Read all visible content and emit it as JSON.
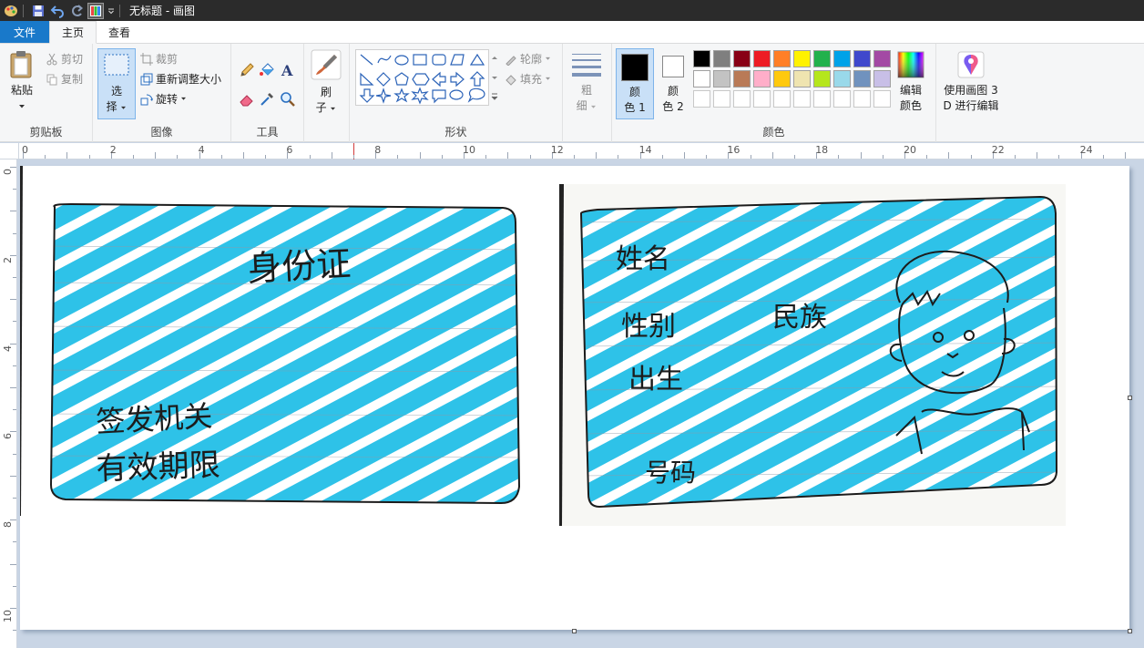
{
  "window": {
    "title": "无标题 - 画图"
  },
  "menu": {
    "file": "文件",
    "tabs": [
      "主页",
      "查看"
    ]
  },
  "clipboard": {
    "paste": "粘贴",
    "cut": "剪切",
    "copy": "复制",
    "group": "剪贴板"
  },
  "image": {
    "select_line1": "选",
    "select_line2": "择",
    "crop": "裁剪",
    "resize": "重新调整大小",
    "rotate": "旋转",
    "group": "图像"
  },
  "tools": {
    "group": "工具"
  },
  "brushes": {
    "line1": "刷",
    "line2": "子"
  },
  "shapes": {
    "outline": "轮廓",
    "fill": "填充",
    "group": "形状"
  },
  "size": {
    "line1": "粗",
    "line2": "细"
  },
  "colors": {
    "color1_line1": "颜",
    "color1_line2": "色 1",
    "color2_line1": "颜",
    "color2_line2": "色 2",
    "edit_line1": "编辑",
    "edit_line2": "颜色",
    "group": "颜色",
    "palette": [
      "#000000",
      "#7f7f7f",
      "#880015",
      "#ed1c24",
      "#ff7f27",
      "#fff200",
      "#22b14c",
      "#00a2e8",
      "#3f48cc",
      "#a349a4",
      "#ffffff",
      "#c3c3c3",
      "#b97a57",
      "#ffaec9",
      "#ffc90e",
      "#efe4b0",
      "#b5e61d",
      "#99d9ea",
      "#7092be",
      "#c8bfe7"
    ],
    "color1": "#000000",
    "color2": "#ffffff"
  },
  "paint3d": {
    "line1": "使用画图 3",
    "line2": "D 进行编辑"
  },
  "ruler": {
    "h": [
      "0",
      "2",
      "4",
      "6",
      "8",
      "10",
      "12",
      "14",
      "16",
      "18",
      "20",
      "22",
      "24"
    ],
    "v": [
      "0",
      "2",
      "4",
      "6",
      "8",
      "10"
    ]
  },
  "drawing": {
    "card_back": {
      "title": "身份证",
      "issuer": "签发机关",
      "validity": "有效期限"
    },
    "card_front": {
      "name": "姓名",
      "gender": "性别",
      "ethnicity": "民族",
      "birth": "出生",
      "number": "号码"
    },
    "stripe_color": "#2ec2e8"
  }
}
